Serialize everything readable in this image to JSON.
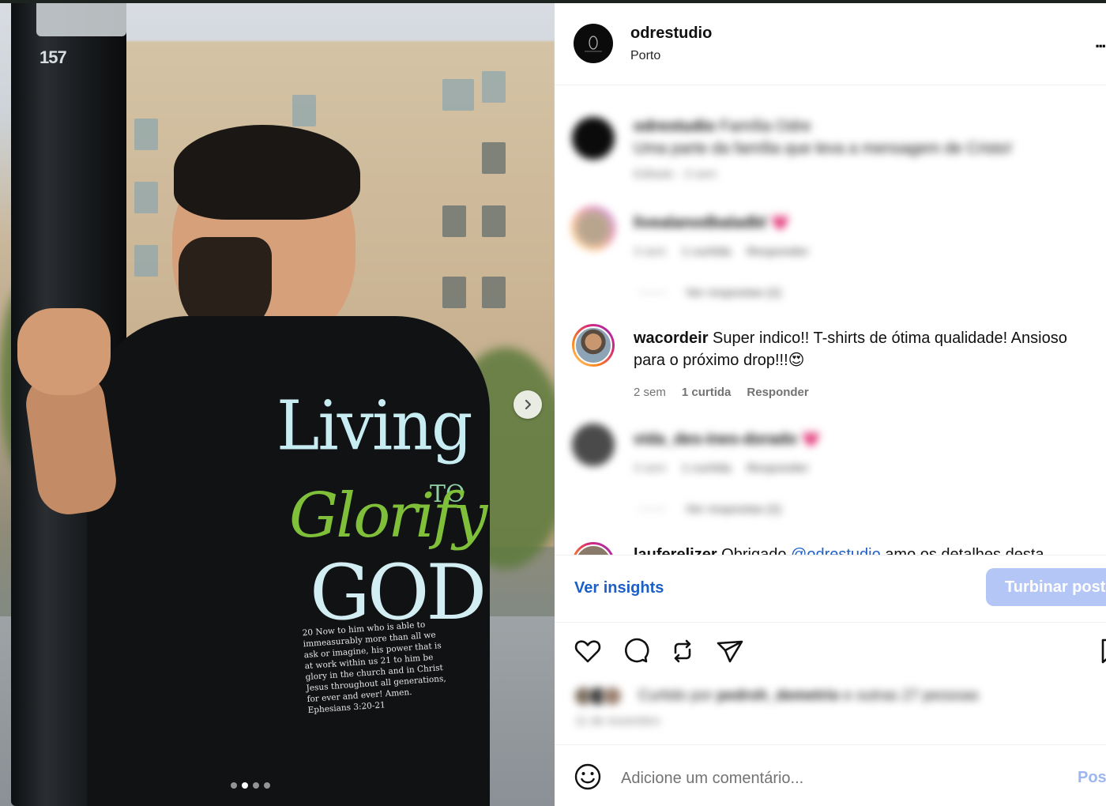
{
  "photo": {
    "pole_number": "157",
    "shirt_print": {
      "line1": "Living",
      "line2": "TO",
      "line3": "Glorify",
      "line4": "GOD",
      "verse": "20 Now to him who is able to immeasurably more than all we ask or imagine, his power that is at work within us 21 to him be glory in the church and in Christ Jesus throughout all generations, for ever and ever! Amen. Ephesians 3:20-21"
    },
    "carousel_dots": 4,
    "carousel_active_index": 1
  },
  "header": {
    "username": "odrestudio",
    "location": "Porto",
    "avatar_icon": "brand-logo-icon",
    "more_label": "..."
  },
  "comments": [
    {
      "username": "odrestudio",
      "text": "Família Odre",
      "text2": "Uma parte da família que leva a mensagem de Cristo!",
      "meta": "Editado · 3 sem",
      "blurred": true
    },
    {
      "username": "livealanodbaladbl",
      "emoji": "💗",
      "time": "3 sem",
      "likes": "1 curtida",
      "reply": "Responder",
      "view_replies": "Ver respostas (1)",
      "blurred": true
    },
    {
      "username": "wacordeir",
      "text": "Super indico!! T-shirts de ótima qualidade! Ansioso para o próximo drop!!!",
      "emoji": "😍",
      "time": "2 sem",
      "likes": "1 curtida",
      "reply": "Responder",
      "blurred": false
    },
    {
      "username": "vida_des-ines-dorado",
      "emoji": "💗",
      "time": "3 sem",
      "likes": "1 curtida",
      "reply": "Responder",
      "view_replies": "Ver respostas (1)",
      "blurred": true
    },
    {
      "username": "lauferelizer",
      "text": "Obrigado",
      "mention": "@odrestudio",
      "text_tail": "amo os detalhes desta",
      "blurred": false
    }
  ],
  "insights": {
    "link_label": "Ver insights",
    "boost_label": "Turbinar post"
  },
  "actions": [
    {
      "icon": "heart-icon"
    },
    {
      "icon": "comment-icon"
    },
    {
      "icon": "repost-icon"
    },
    {
      "icon": "share-icon"
    },
    {
      "icon": "bookmark-icon"
    }
  ],
  "likes": {
    "prefix": "Curtido por",
    "user": "pedroh_demetrio",
    "suffix": "e outras 27 pessoas",
    "date": "11 de novembro"
  },
  "add_comment": {
    "placeholder": "Adicione um comentário...",
    "post_label": "Post",
    "emoji_icon": "smiley-icon"
  },
  "colors": {
    "link_blue": "#1c5fc7",
    "boost_bg": "#b4c6f5",
    "post_disabled": "#9bb6f0",
    "shirt_green": "#7fbf3a",
    "shirt_light": "#c7ecf1"
  }
}
